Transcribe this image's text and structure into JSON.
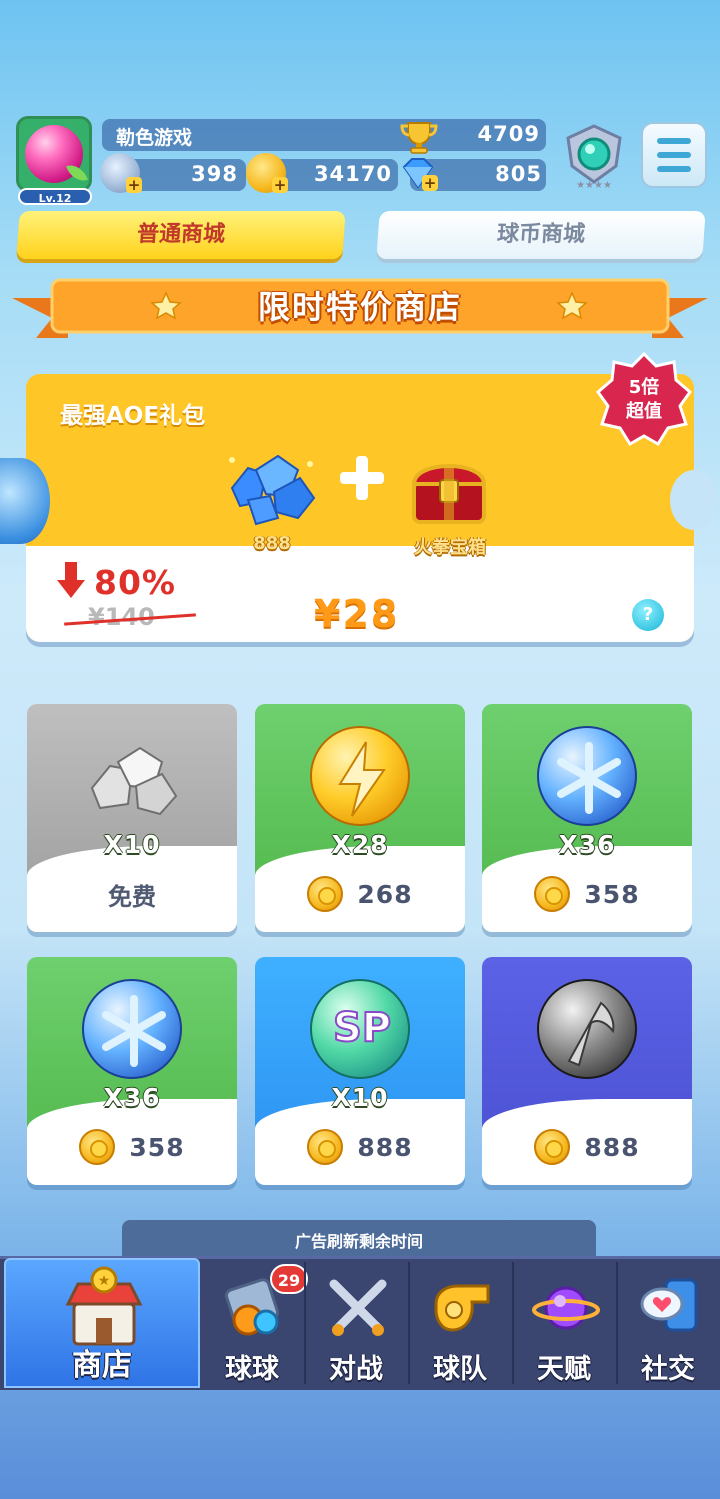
{
  "player": {
    "name": "勒色游戏",
    "level": "Lv.12",
    "trophies": "4709"
  },
  "resources": {
    "stamina": "398",
    "coins": "34170",
    "gems": "805"
  },
  "tabs": {
    "normal_shop": "普通商城",
    "ball_coin_shop": "球币商城"
  },
  "banner": {
    "title": "限时特价商店"
  },
  "deal": {
    "title": "最强AOE礼包",
    "badge_line1": "5倍",
    "badge_line2": "超值",
    "item1_label": "888",
    "item2_label": "火拳宝箱",
    "discount": "80%",
    "old_price": "¥140",
    "new_price": "¥28",
    "help": "?"
  },
  "items": [
    {
      "qty": "X10",
      "price": "",
      "free_label": "免费",
      "icon": "silver-stones-icon"
    },
    {
      "qty": "X28",
      "price": "268",
      "icon": "lightning-ball-icon"
    },
    {
      "qty": "X36",
      "price": "358",
      "icon": "snowflake-ball-icon"
    },
    {
      "qty": "X36",
      "price": "358",
      "icon": "snowflake-ball-icon"
    },
    {
      "qty": "X10",
      "price": "888",
      "icon": "sp-ball-icon"
    },
    {
      "qty": "",
      "price": "888",
      "icon": "scythe-ball-icon"
    }
  ],
  "ad_timer": {
    "label": "广告刷新剩余时间"
  },
  "nav": {
    "shop": "商店",
    "balls": "球球",
    "balls_badge": "29",
    "battle": "对战",
    "team": "球队",
    "talent": "天赋",
    "social": "社交"
  },
  "colors": {
    "primary_yellow": "#ffd21c",
    "deal_orange": "#ffc628",
    "price_orange": "#ff9a18",
    "discount_red": "#e0302a",
    "nav_bg": "#3a4570",
    "nav_active": "#2f74e6"
  }
}
